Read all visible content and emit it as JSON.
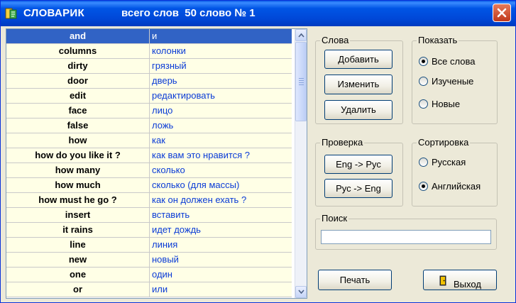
{
  "titlebar": {
    "app_name": "СЛОВАРИК",
    "status": "всего слов  50 слово № 1",
    "icon": "app-icon",
    "close_icon": "close-icon"
  },
  "colors": {
    "titlebar": "#0055e5",
    "selection": "#3163c5",
    "translation_text": "#0a3bd6",
    "cell_bg": "#ffffe6",
    "close": "#c0391c"
  },
  "words": [
    {
      "eng": "and",
      "rus": "и",
      "selected": true
    },
    {
      "eng": "columns",
      "rus": "колонки"
    },
    {
      "eng": "dirty",
      "rus": "грязный"
    },
    {
      "eng": "door",
      "rus": "дверь"
    },
    {
      "eng": "edit",
      "rus": "редактировать"
    },
    {
      "eng": "face",
      "rus": "лицо"
    },
    {
      "eng": "false",
      "rus": "ложь"
    },
    {
      "eng": "how",
      "rus": "как"
    },
    {
      "eng": "how do you like it ?",
      "rus": "как вам это нравится ?"
    },
    {
      "eng": "how many",
      "rus": "сколько"
    },
    {
      "eng": "how much",
      "rus": "сколько (для массы)"
    },
    {
      "eng": "how must he go ?",
      "rus": "как он должен ехать ?"
    },
    {
      "eng": "insert",
      "rus": "вставить"
    },
    {
      "eng": "it rains",
      "rus": "идет дождь"
    },
    {
      "eng": "line",
      "rus": "линия"
    },
    {
      "eng": "new",
      "rus": "новый"
    },
    {
      "eng": "one",
      "rus": "один"
    },
    {
      "eng": "or",
      "rus": "или"
    }
  ],
  "scrollbar": {
    "up_icon": "scroll-up-arrow-icon",
    "down_icon": "scroll-down-arrow-icon"
  },
  "words_group": {
    "title": "Слова",
    "add": "Добавить",
    "edit": "Изменить",
    "delete": "Удалить"
  },
  "show_group": {
    "title": "Показать",
    "options": [
      "Все слова",
      "Изученые",
      "Новые"
    ],
    "selected": "Все слова"
  },
  "check_group": {
    "title": "Проверка",
    "eng_rus": "Eng -> Рус",
    "rus_eng": "Рус -> Eng"
  },
  "sort_group": {
    "title": "Сортировка",
    "options": [
      "Русская",
      "Английская"
    ],
    "selected": "Английская"
  },
  "search": {
    "title": "Поиск",
    "value": ""
  },
  "footer": {
    "print": "Печать",
    "exit": "Выход",
    "exit_icon": "door-exit-icon"
  }
}
